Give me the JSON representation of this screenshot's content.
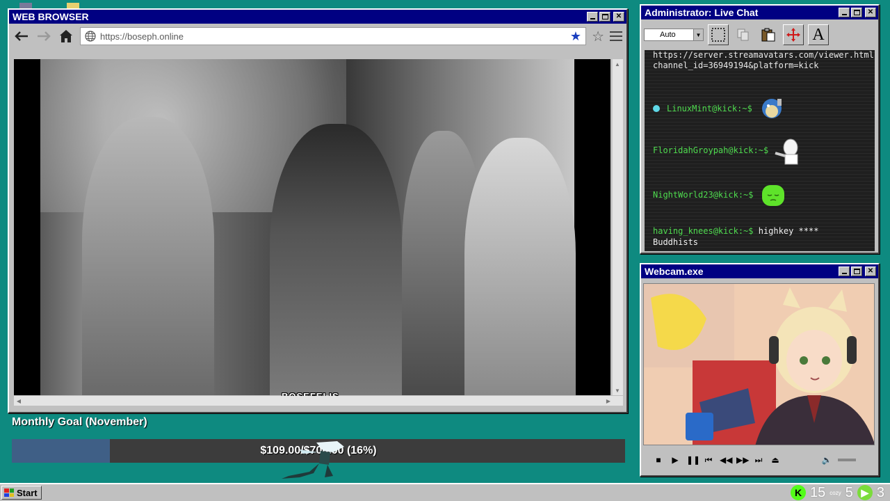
{
  "browser": {
    "title": "WEB BROWSER",
    "url": "https://boseph.online",
    "caption": "BOSEFELIS"
  },
  "goal": {
    "title": "Monthly Goal (November)",
    "text": "$109.00/$700.00 (16%)",
    "fraction": 0.16
  },
  "chat": {
    "title": "Administrator: Live Chat",
    "font_size_value": "Auto",
    "url_text": "https://server.streamavatars.com/viewer.html?channel_id=36949194&platform=kick",
    "messages": [
      {
        "user": "LinuxMint@kick:~$",
        "text": ""
      },
      {
        "user": "FloridahGroypah@kick:~$",
        "text": ""
      },
      {
        "user": "NightWorld23@kick:~$",
        "text": ""
      },
      {
        "user": "having_knees@kick:~$",
        "text": "highkey **** Buddhists"
      }
    ]
  },
  "webcam": {
    "title": "Webcam.exe"
  },
  "taskbar": {
    "start_label": "Start",
    "tray_count_1": "15",
    "tray_cozy": "cozy",
    "tray_count_2": "5",
    "tray_count_3": "3"
  },
  "colors": {
    "desktop": "#0e8a80",
    "titlebar": "#000082",
    "chat_username": "#4fdc4f",
    "goal_fill": "#3f5f86",
    "kick_green": "#53fc18"
  }
}
